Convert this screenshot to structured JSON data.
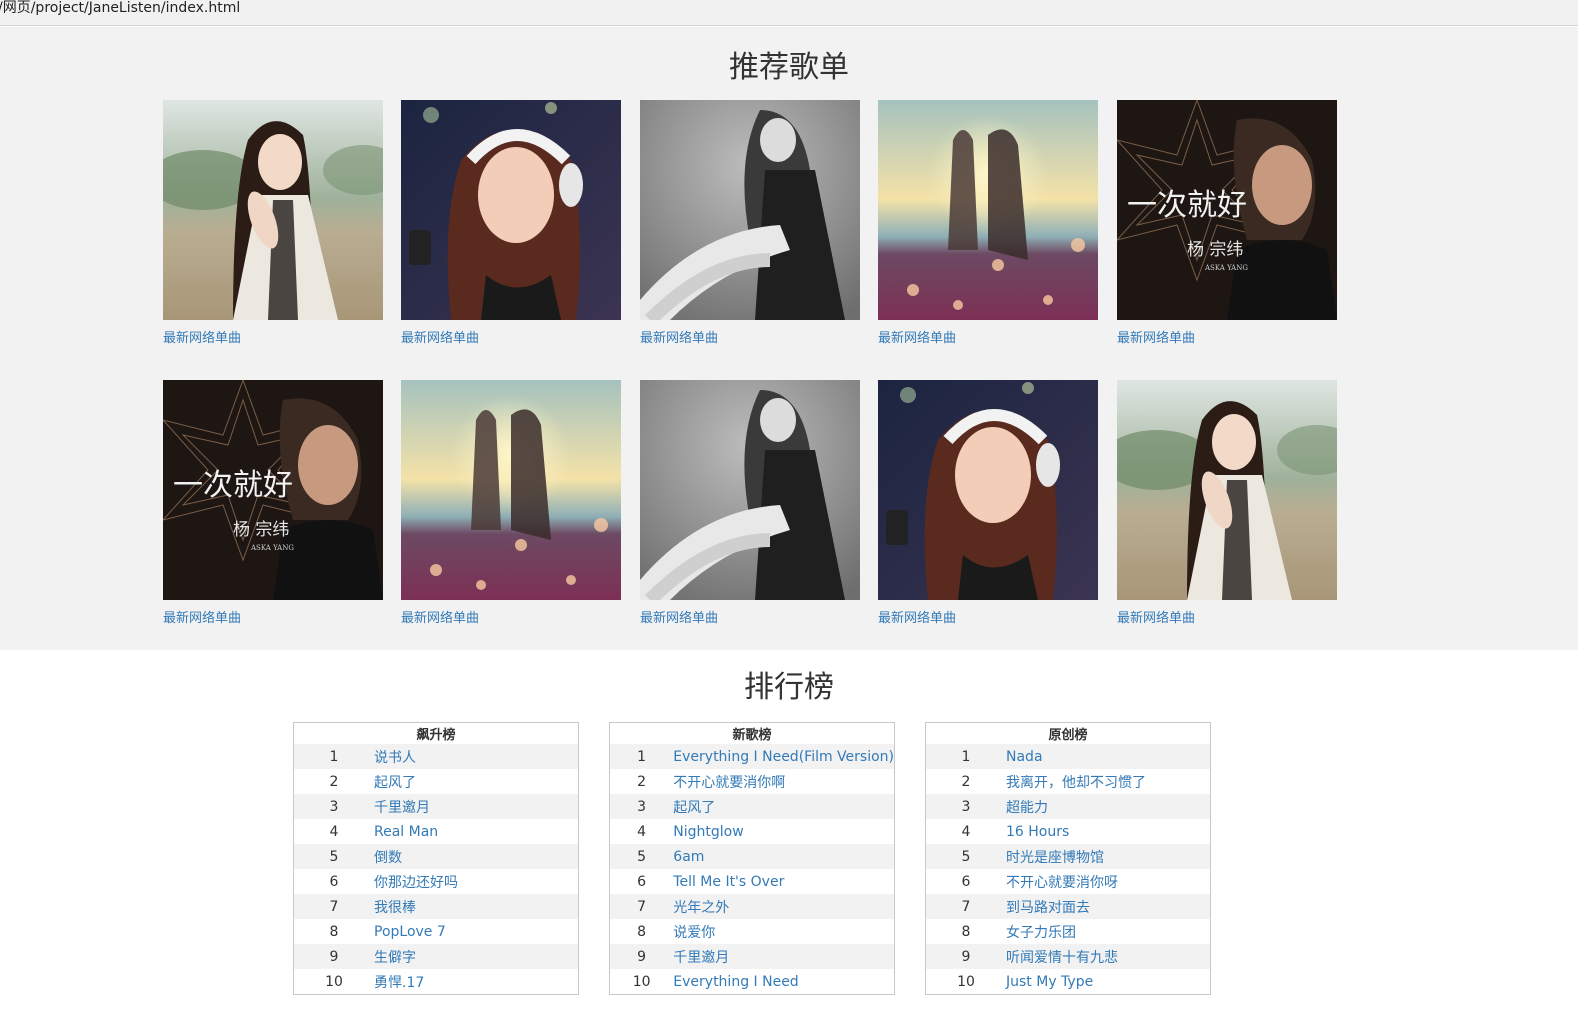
{
  "address_bar": {
    "url": "/网页/project/JaneListen/index.html"
  },
  "recommend": {
    "title": "推荐歌单",
    "items": [
      {
        "label": "最新网络单曲",
        "cover": "girl-field"
      },
      {
        "label": "最新网络单曲",
        "cover": "girl-headphones"
      },
      {
        "label": "最新网络单曲",
        "cover": "bw-model"
      },
      {
        "label": "最新网络单曲",
        "cover": "sunset-couple"
      },
      {
        "label": "最新网络单曲",
        "cover": "yang-album"
      },
      {
        "label": "最新网络单曲",
        "cover": "yang-album"
      },
      {
        "label": "最新网络单曲",
        "cover": "sunset-couple"
      },
      {
        "label": "最新网络单曲",
        "cover": "bw-model"
      },
      {
        "label": "最新网络单曲",
        "cover": "girl-headphones"
      },
      {
        "label": "最新网络单曲",
        "cover": "girl-field"
      }
    ],
    "album_text": {
      "title": "一次就好",
      "artist": "杨 宗纬",
      "artist_en": "ASKA YANG"
    }
  },
  "rankings": {
    "title": "排行榜",
    "charts": [
      {
        "name": "飙升榜",
        "songs": [
          "说书人",
          "起风了",
          "千里邀月",
          "Real Man",
          "倒数",
          "你那边还好吗",
          "我很棒",
          "PopLove 7",
          "生僻字",
          "勇悍.17"
        ]
      },
      {
        "name": "新歌榜",
        "songs": [
          "Everything I Need(Film Version)",
          "不开心就要消你啊",
          "起风了",
          "Nightglow",
          "6am",
          "Tell Me It's Over",
          "光年之外",
          "说爱你",
          "千里邀月",
          "Everything I Need"
        ]
      },
      {
        "name": "原创榜",
        "songs": [
          "Nada",
          "我离开，他却不习惯了",
          "超能力",
          "16 Hours",
          "时光是座博物馆",
          "不开心就要消你呀",
          "到马路对面去",
          "女子力乐团",
          "听闻爱情十有九悲",
          "Just My Type"
        ]
      }
    ]
  }
}
